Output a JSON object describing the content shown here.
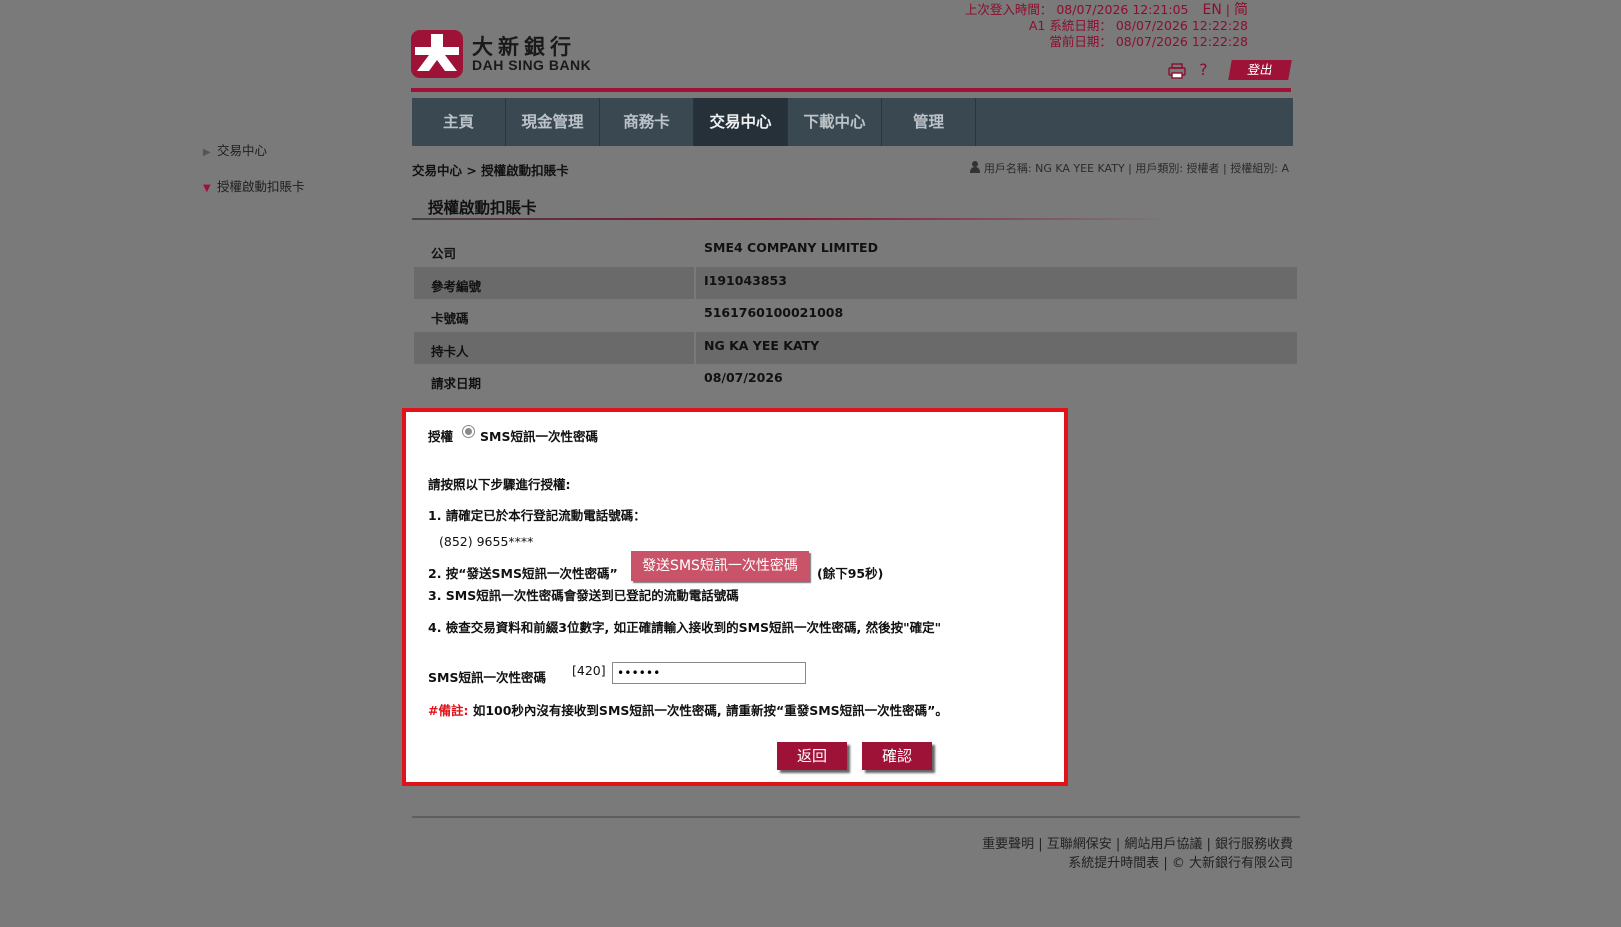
{
  "header": {
    "last_login": "上次登入時間： 08/07/2026 12:21:05",
    "lang_en": "EN",
    "lang_sep": "|",
    "lang_sc": "简",
    "system_date": "A1 系統日期： 08/07/2026 12:22:28",
    "current_date": "當前日期： 08/07/2026 12:22:28",
    "bank_name_cn": "大新銀行",
    "bank_name_en": "DAH SING BANK",
    "print_icon": "printer-icon",
    "help_label": "?",
    "logout_label": "登出"
  },
  "nav": {
    "items": [
      "主頁",
      "現金管理",
      "商務卡",
      "交易中心",
      "下載中心",
      "管理"
    ],
    "active_index": 3
  },
  "sidebar": {
    "items": [
      {
        "label": "交易中心",
        "expanded": false
      },
      {
        "label": "授權啟動扣賬卡",
        "expanded": true
      }
    ]
  },
  "breadcrumb": "交易中心 > 授權啟動扣賬卡",
  "user_info": "用戶名稱: NG KA YEE KATY | 用戶類別: 授權者 | 授權組別: A",
  "page_title": "授權啟動扣賬卡",
  "details": [
    {
      "label": "公司",
      "value": "SME4 COMPANY LIMITED"
    },
    {
      "label": "參考編號",
      "value": "I191043853"
    },
    {
      "label": "卡號碼",
      "value": "5161760100021008"
    },
    {
      "label": "持卡人",
      "value": "NG KA YEE KATY"
    },
    {
      "label": "請求日期",
      "value": "08/07/2026"
    }
  ],
  "auth": {
    "label": "授權",
    "method": "SMS短訊一次性密碼",
    "instructions_heading": "請按照以下步驟進行授權:",
    "step1": "1. 請確定已於本行登記流動電話號碼：",
    "phone": "(852) 9655****",
    "step2": "2. 按“發送SMS短訊一次性密碼”",
    "send_button": "發送SMS短訊一次性密碼",
    "countdown": "(餘下95秒)",
    "step3": "3. SMS短訊一次性密碼會發送到已登記的流動電話號碼",
    "step4": "4. 檢查交易資料和前綴3位數字, 如正確請輸入接收到的SMS短訊一次性密碼, 然後按\"確定\"",
    "otp_label": "SMS短訊一次性密碼",
    "otp_prefix": "[420]",
    "otp_value": "••••••",
    "note_label": "#備註:",
    "note_text": "如100秒內沒有接收到SMS短訊一次性密碼, 請重新按“重發SMS短訊一次性密碼”。",
    "back_button": "返回",
    "confirm_button": "確認"
  },
  "footer": {
    "line1": "重要聲明 | 互聯網保安 | 網站用戶協議 | 銀行服務收費",
    "line2": "系統提升時間表 | © 大新銀行有限公司"
  },
  "colors": {
    "brand": "#9e1238",
    "nav_bg": "#3a4852",
    "highlight_border": "#e0131a",
    "page_bg": "#7a7a7a"
  }
}
